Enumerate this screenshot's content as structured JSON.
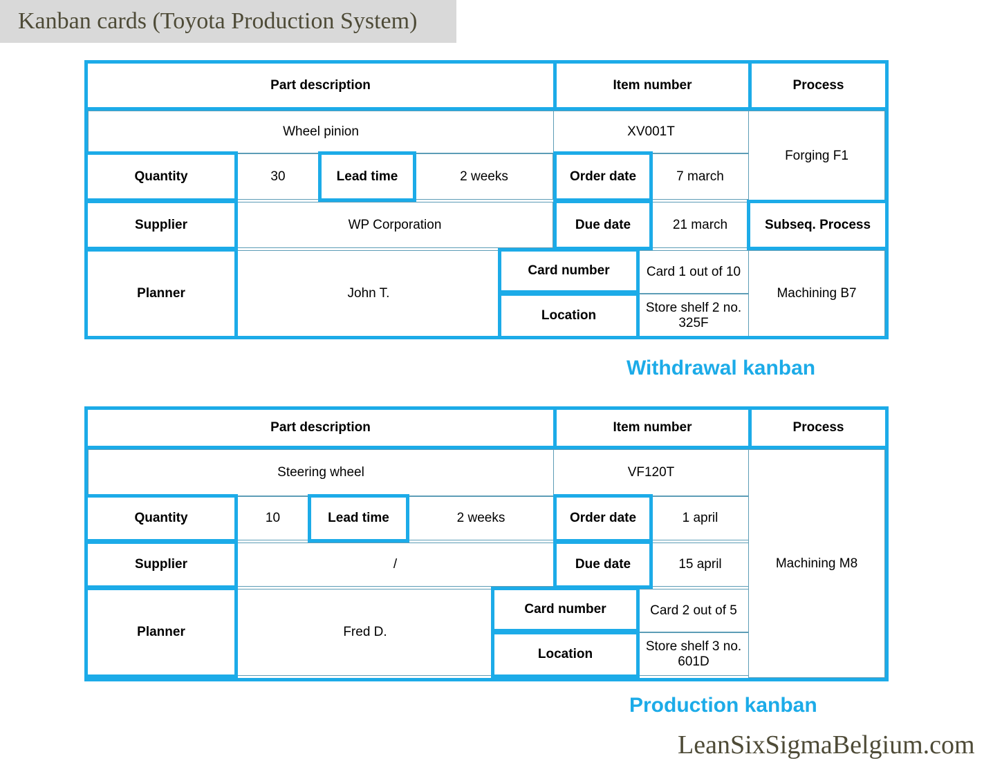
{
  "title": "Kanban cards (Toyota Production System)",
  "footer_brand": "LeanSixSigmaBelgium.com",
  "colors": {
    "accent_blue": "#1cabe8",
    "thin_border": "#5c9cb6",
    "title_band_bg": "#d9d9d9",
    "title_text": "#4e4b37"
  },
  "cards": [
    {
      "caption": "Withdrawal kanban",
      "headers": {
        "part_description": "Part description",
        "item_number": "Item number",
        "process": "Process"
      },
      "labels": {
        "quantity": "Quantity",
        "lead_time": "Lead time",
        "order_date": "Order date",
        "supplier": "Supplier",
        "due_date": "Due date",
        "subseq_process": "Subseq. Process",
        "planner": "Planner",
        "card_number": "Card number",
        "location": "Location"
      },
      "values": {
        "part_description": "Wheel  pinion",
        "item_number": "XV001T",
        "process": "Forging F1",
        "quantity": "30",
        "lead_time": "2 weeks",
        "order_date": "7 march",
        "supplier": "WP Corporation",
        "due_date": "21 march",
        "subseq_process": "Machining B7",
        "planner": "John T.",
        "card_number": "Card 1 out of 10",
        "location": "Store shelf 2 no. 325F"
      }
    },
    {
      "caption": "Production kanban",
      "headers": {
        "part_description": "Part description",
        "item_number": "Item number",
        "process": "Process"
      },
      "labels": {
        "quantity": "Quantity",
        "lead_time": "Lead time",
        "order_date": "Order date",
        "supplier": "Supplier",
        "due_date": "Due date",
        "planner": "Planner",
        "card_number": "Card number",
        "location": "Location"
      },
      "values": {
        "part_description": "Steering wheel",
        "item_number": "VF120T",
        "process": "Machining M8",
        "quantity": "10",
        "lead_time": "2 weeks",
        "order_date": "1 april",
        "supplier": "/",
        "due_date": "15 april",
        "planner": "Fred D.",
        "card_number": "Card 2 out of 5",
        "location": "Store shelf 3 no. 601D"
      }
    }
  ]
}
